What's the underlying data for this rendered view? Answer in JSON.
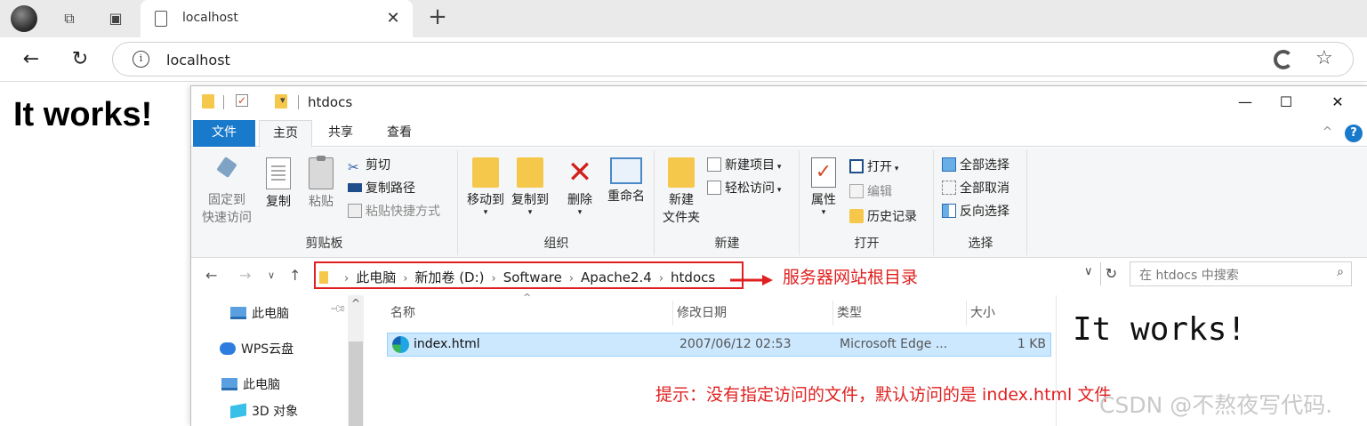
{
  "browser": {
    "tab_title": "localhost",
    "url": "localhost",
    "close_glyph": "✕",
    "newtab_glyph": "+",
    "back_glyph": "←",
    "reload_glyph": "↻",
    "info_glyph": "i",
    "favorite_glyph": "☆"
  },
  "page": {
    "heading": "It works!"
  },
  "explorer": {
    "title": "htdocs",
    "window_buttons": {
      "minimize": "—",
      "maximize": "☐",
      "close": "✕"
    },
    "ribbon_tabs": [
      "文件",
      "主页",
      "共享",
      "查看"
    ],
    "help_glyph": "?",
    "collapse_glyph": "^",
    "groups": {
      "clipboard": {
        "label": "剪贴板",
        "pin_line1": "固定到",
        "pin_line2": "快速访问",
        "copy": "复制",
        "paste": "粘贴",
        "cut": "剪切",
        "copy_path": "复制路径",
        "paste_shortcut": "粘贴快捷方式"
      },
      "organize": {
        "label": "组织",
        "move_to": "移动到",
        "copy_to": "复制到",
        "delete": "删除",
        "rename": "重命名"
      },
      "new": {
        "label": "新建",
        "new_folder_line1": "新建",
        "new_folder_line2": "文件夹",
        "new_item": "新建项目",
        "easy_access": "轻松访问"
      },
      "open": {
        "label": "打开",
        "properties": "属性",
        "open": "打开",
        "edit": "编辑",
        "history": "历史记录"
      },
      "select": {
        "label": "选择",
        "select_all": "全部选择",
        "select_none": "全部取消",
        "invert": "反向选择"
      }
    },
    "breadcrumbs": [
      "此电脑",
      "新加卷 (D:)",
      "Software",
      "Apache2.4",
      "htdocs"
    ],
    "search_placeholder": "在 htdocs 中搜索",
    "annotation_root": "服务器网站根目录",
    "nav": [
      "此电脑",
      "WPS云盘",
      "此电脑",
      "3D 对象"
    ],
    "columns": [
      "名称",
      "修改日期",
      "类型",
      "大小"
    ],
    "files": [
      {
        "name": "index.html",
        "date": "2007/06/12 02:53",
        "type": "Microsoft Edge ...",
        "size": "1 KB"
      }
    ],
    "annotation_hint": "提示：没有指定访问的文件，默认访问的是 index.html 文件",
    "preview_heading": "It works!"
  },
  "watermark": "CSDN @不熬夜写代码.",
  "colors": {
    "accent": "#1979ca",
    "annotation": "#e02020",
    "selection": "#cce8ff"
  }
}
